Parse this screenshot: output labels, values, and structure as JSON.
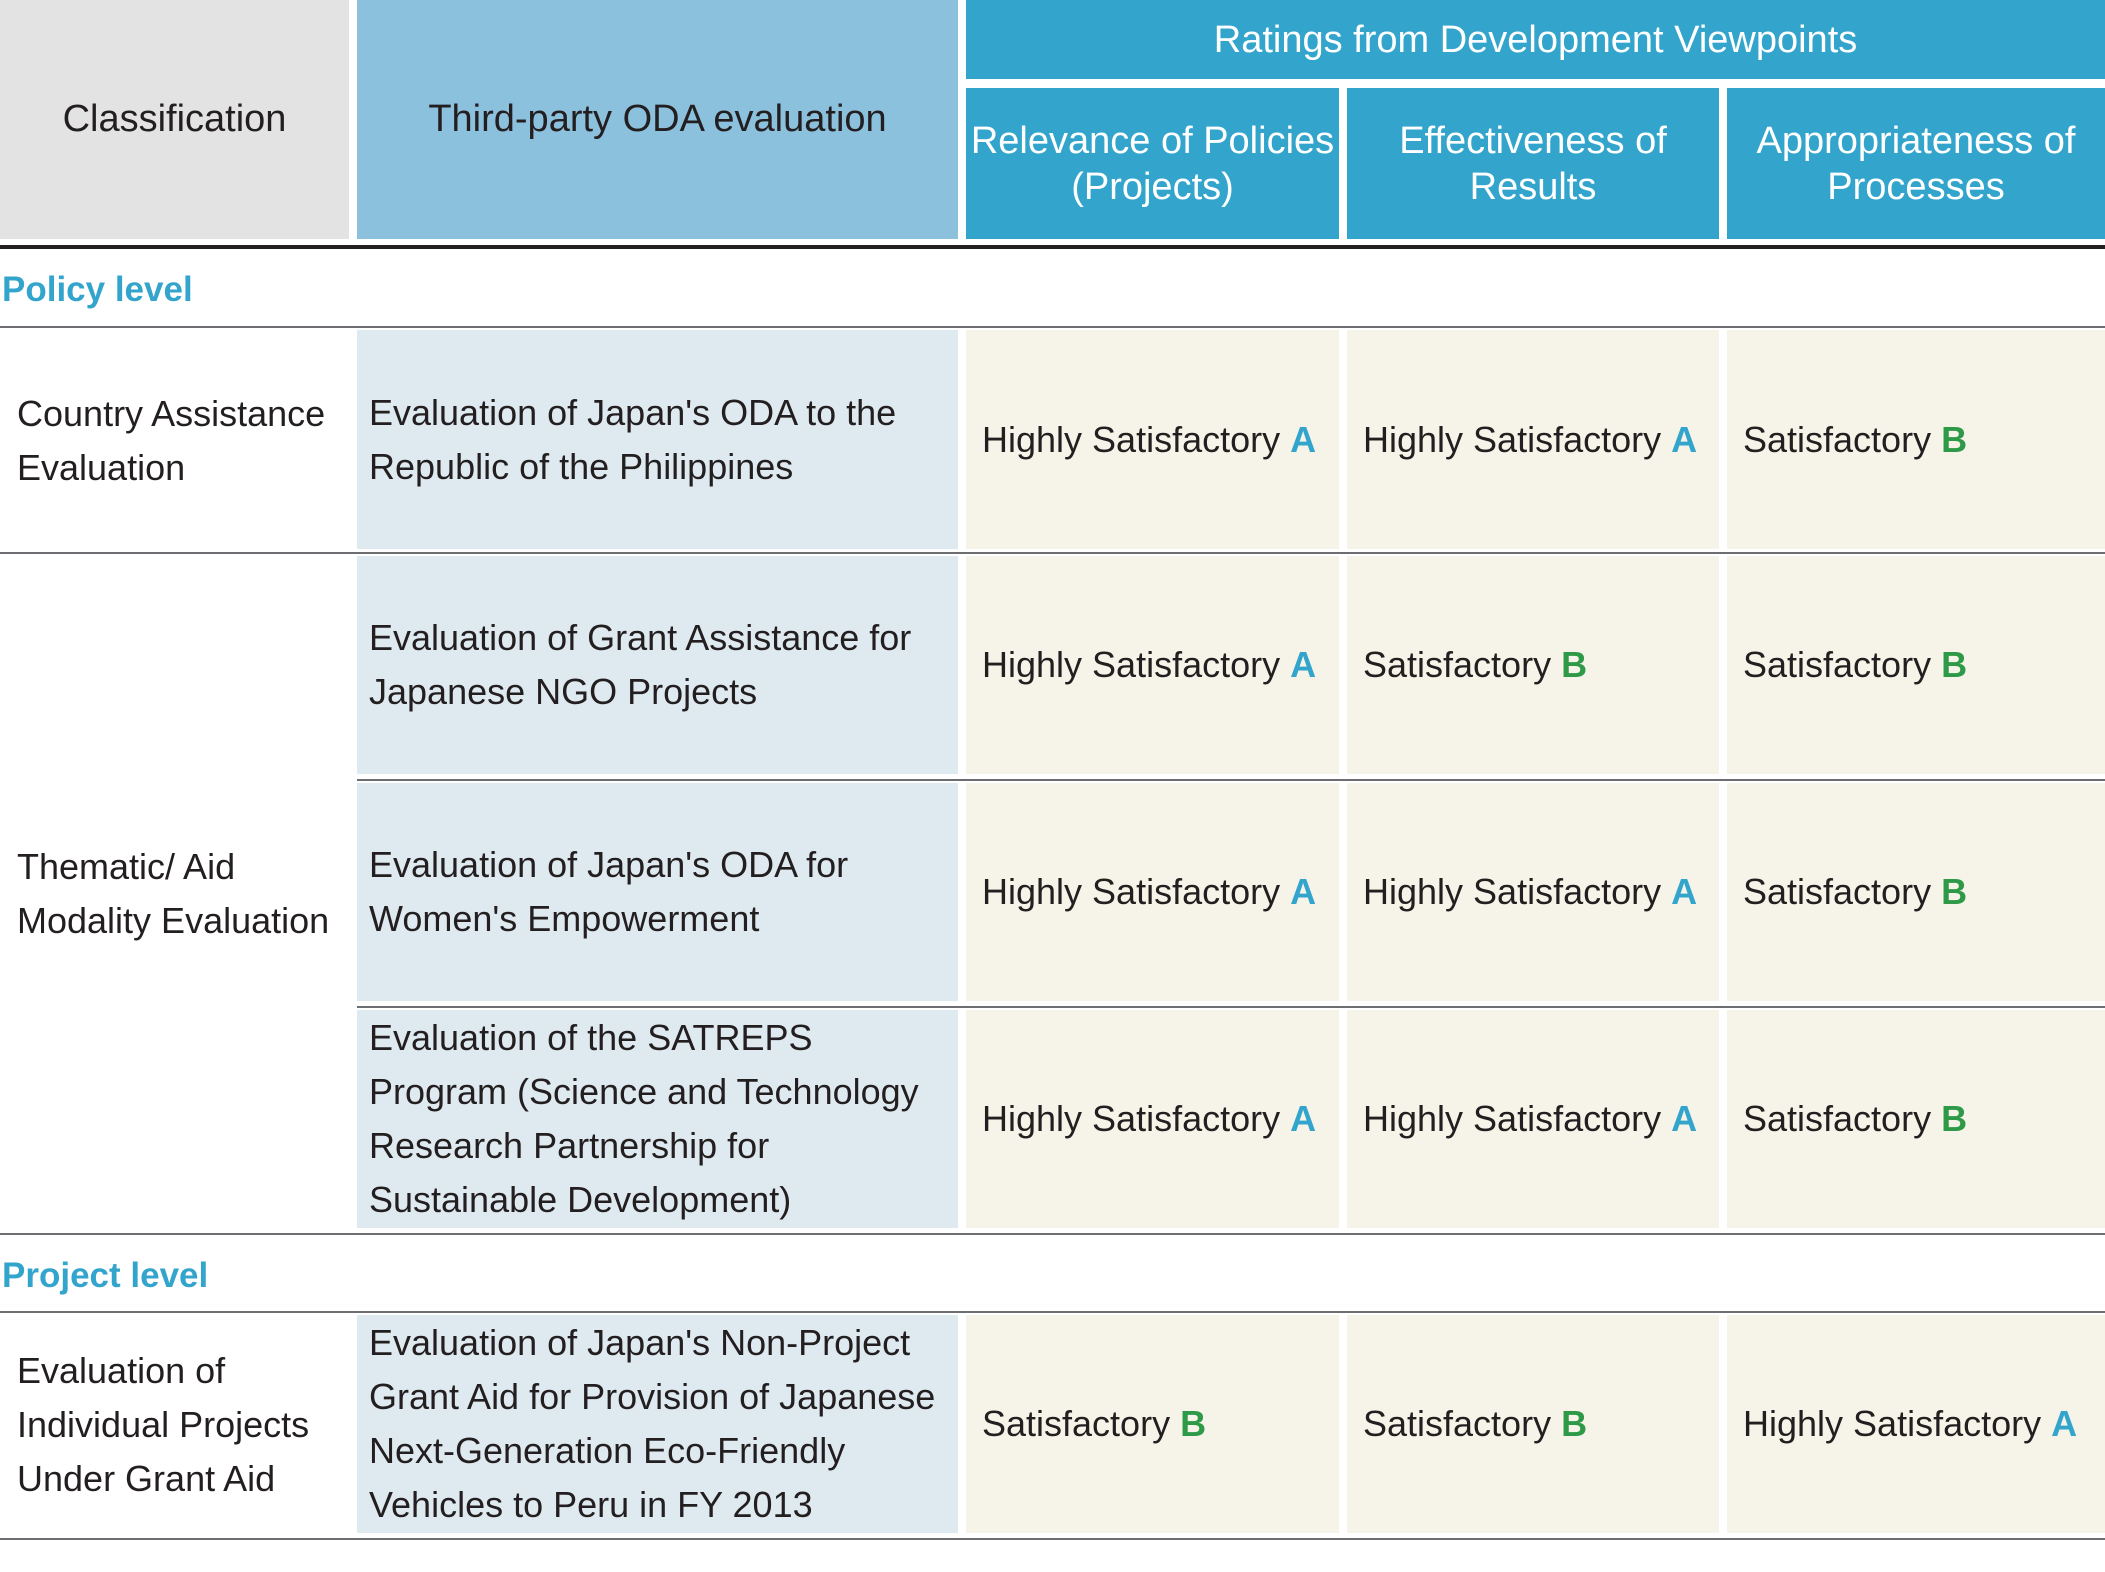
{
  "header": {
    "classification": "Classification",
    "third_party": "Third-party ODA evaluation",
    "ratings_group": "Ratings from Development Viewpoints",
    "relevance": "Relevance of Policies (Projects)",
    "effectiveness": "Effectiveness of Results",
    "appropriateness": "Appropriateness of Processes"
  },
  "sections": {
    "policy": "Policy level",
    "project": "Project level"
  },
  "classes": {
    "country": "Country Assistance Evaluation",
    "thematic": "Thematic/ Aid Modality Evaluation",
    "individual": "Evaluation of Individual Projects Under Grant Aid"
  },
  "grade_colors": {
    "A": "#33a5cc",
    "B": "#2e9a48"
  },
  "rows": [
    {
      "evaluation": "Evaluation of Japan's ODA to the Republic of the Philippines",
      "ratings": [
        {
          "label": "Highly Satisfactory",
          "grade": "A"
        },
        {
          "label": "Highly Satisfactory",
          "grade": "A"
        },
        {
          "label": "Satisfactory",
          "grade": "B"
        }
      ]
    },
    {
      "evaluation": "Evaluation of Grant Assistance for Japanese NGO Projects",
      "ratings": [
        {
          "label": "Highly Satisfactory",
          "grade": "A"
        },
        {
          "label": "Satisfactory",
          "grade": "B"
        },
        {
          "label": "Satisfactory",
          "grade": "B"
        }
      ]
    },
    {
      "evaluation": "Evaluation of Japan's ODA for Women's Empowerment",
      "ratings": [
        {
          "label": "Highly Satisfactory",
          "grade": "A"
        },
        {
          "label": "Highly Satisfactory",
          "grade": "A"
        },
        {
          "label": "Satisfactory",
          "grade": "B"
        }
      ]
    },
    {
      "evaluation": "Evaluation of the SATREPS Program (Science and Technology Research Partnership for Sustainable Development)",
      "ratings": [
        {
          "label": "Highly Satisfactory",
          "grade": "A"
        },
        {
          "label": "Highly Satisfactory",
          "grade": "A"
        },
        {
          "label": "Satisfactory",
          "grade": "B"
        }
      ]
    },
    {
      "evaluation": "Evaluation of Japan's Non-Project Grant Aid for Provision of Japanese Next-Generation Eco-Friendly Vehicles to Peru in FY 2013",
      "ratings": [
        {
          "label": "Satisfactory",
          "grade": "B"
        },
        {
          "label": "Satisfactory",
          "grade": "B"
        },
        {
          "label": "Highly Satisfactory",
          "grade": "A"
        }
      ]
    }
  ]
}
